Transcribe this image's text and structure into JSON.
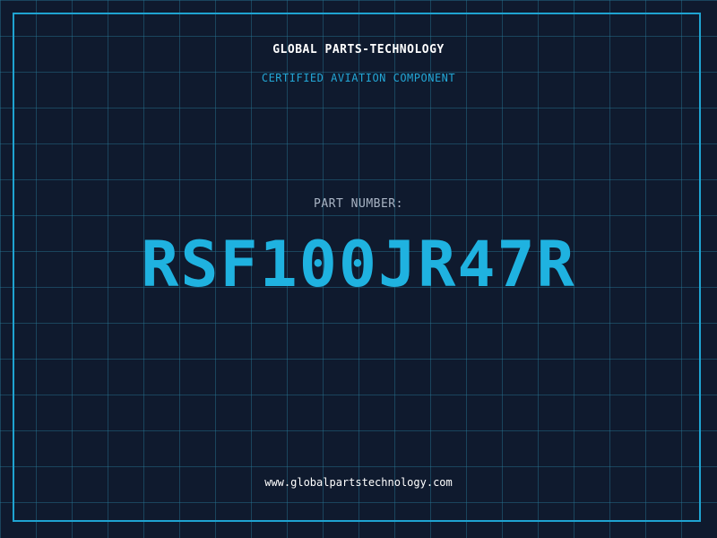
{
  "header": {
    "company": "GLOBAL PARTS-TECHNOLOGY",
    "subtitle": "CERTIFIED AVIATION COMPONENT"
  },
  "part": {
    "label": "PART NUMBER:",
    "number": "RSF100JR47R"
  },
  "footer": {
    "website": "www.globalpartstechnology.com"
  },
  "colors": {
    "background": "#0f1a2e",
    "accent": "#1fb2e0",
    "frame": "#1fa3d1",
    "grid": "#287896"
  }
}
